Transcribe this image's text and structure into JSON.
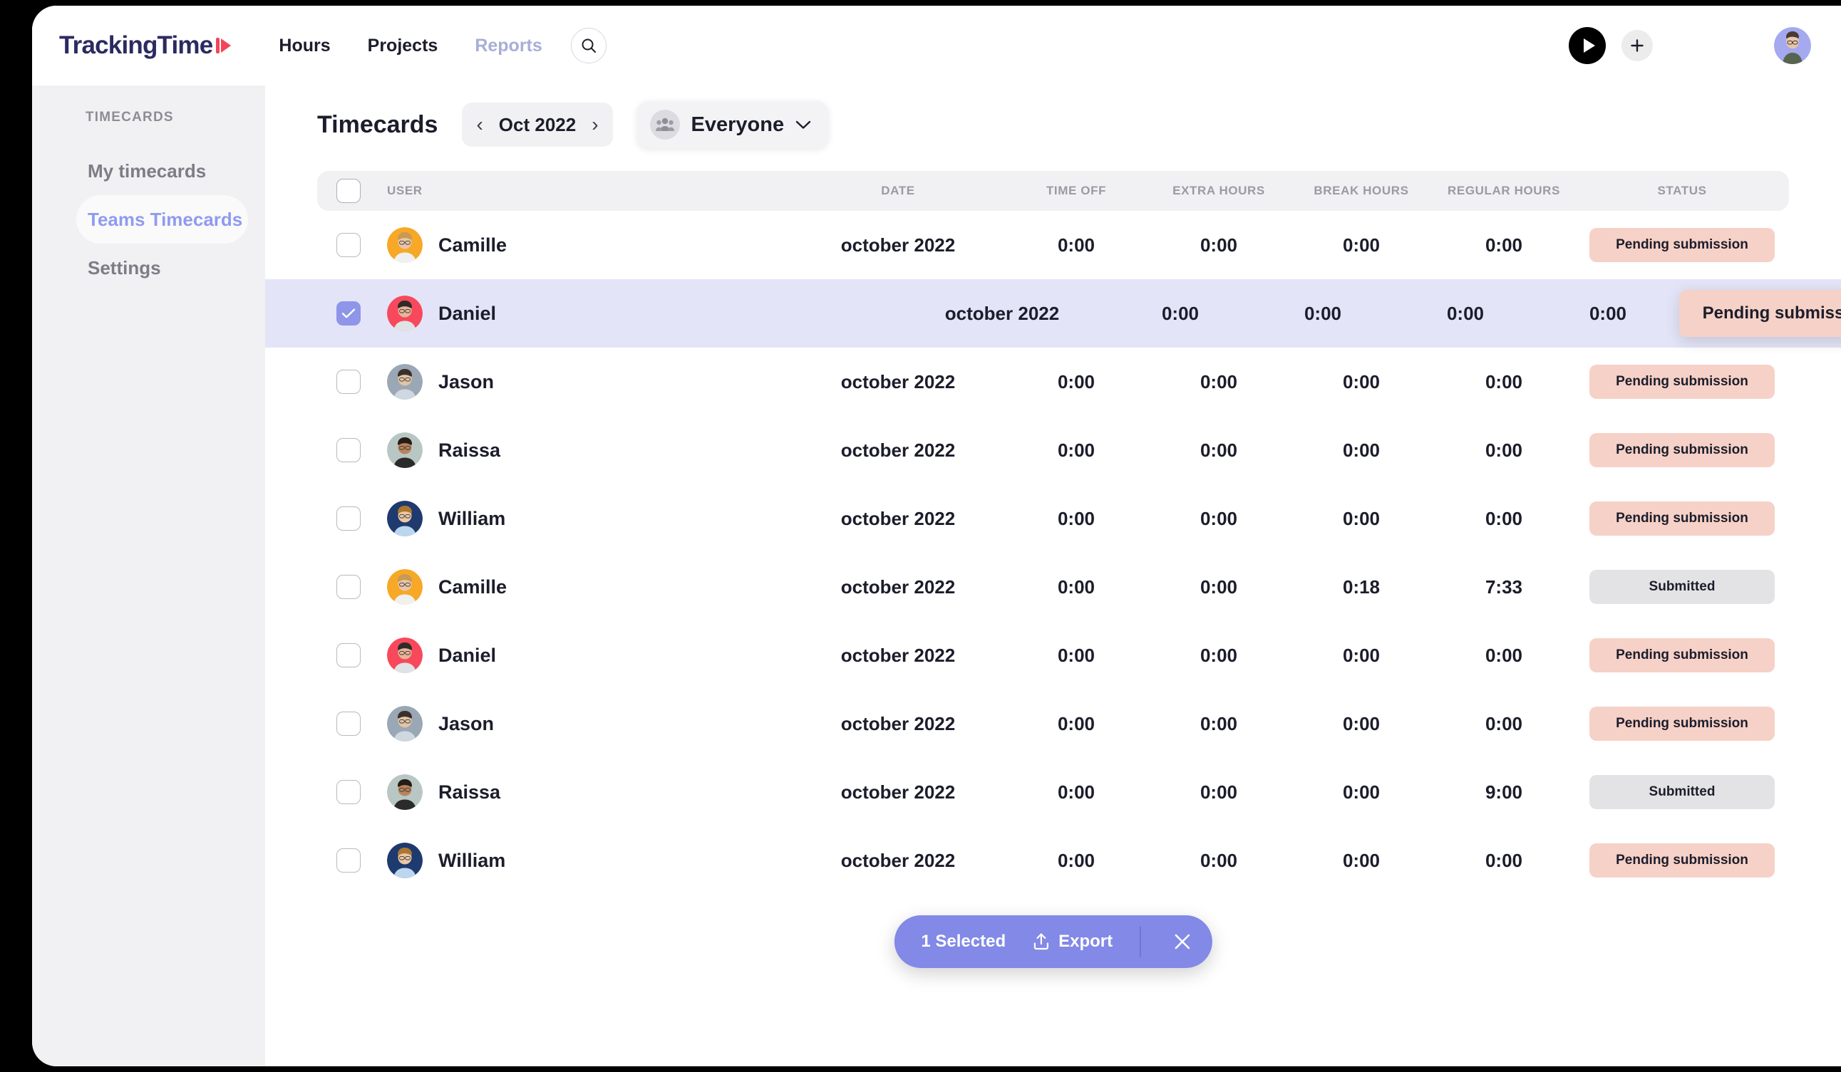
{
  "brand": {
    "name": "TrackingTime",
    "logo_color": "#2b2b60",
    "mark_color": "#f4455a"
  },
  "topnav": {
    "items": [
      {
        "label": "Hours",
        "active": true
      },
      {
        "label": "Projects",
        "active": true
      },
      {
        "label": "Reports",
        "active": false
      }
    ],
    "search_icon": "search-icon",
    "play_icon": "play-icon",
    "add_icon": "plus-icon",
    "avatar_bg": "#a5a9f0"
  },
  "sidebar": {
    "section_title": "TIMECARDS",
    "items": [
      {
        "label": "My timecards",
        "active": false
      },
      {
        "label": "Teams Timecards",
        "active": true
      },
      {
        "label": "Settings",
        "active": false
      }
    ],
    "active_color": "#8f9bf0",
    "bg": "#f1f1f3"
  },
  "header": {
    "title": "Timecards",
    "date_prev_icon": "chevron-left-icon",
    "date_label": "Oct 2022",
    "date_next_icon": "chevron-right-icon",
    "team_icon": "people-group-icon",
    "team_label": "Everyone",
    "team_caret_icon": "chevron-down-icon"
  },
  "table": {
    "columns": [
      "USER",
      "DATE",
      "TIME OFF",
      "EXTRA HOURS",
      "BREAK HOURS",
      "REGULAR HOURS",
      "STATUS"
    ],
    "rows": [
      {
        "user": "Camille",
        "avatar_bg": "#f7a827",
        "date": "october 2022",
        "time_off": "0:00",
        "extra_hours": "0:00",
        "break_hours": "0:00",
        "regular_hours": "0:00",
        "status": "Pending submission",
        "status_kind": "pending",
        "selected": false
      },
      {
        "user": "Daniel",
        "avatar_bg": "#f8495c",
        "date": "october 2022",
        "time_off": "0:00",
        "extra_hours": "0:00",
        "break_hours": "0:00",
        "regular_hours": "0:00",
        "status": "Pending submission",
        "status_kind": "pending",
        "selected": true
      },
      {
        "user": "Jason",
        "avatar_bg": "#9aa7b4",
        "date": "october 2022",
        "time_off": "0:00",
        "extra_hours": "0:00",
        "break_hours": "0:00",
        "regular_hours": "0:00",
        "status": "Pending submission",
        "status_kind": "pending",
        "selected": false
      },
      {
        "user": "Raissa",
        "avatar_bg": "#b9c7c4",
        "date": "october 2022",
        "time_off": "0:00",
        "extra_hours": "0:00",
        "break_hours": "0:00",
        "regular_hours": "0:00",
        "status": "Pending submission",
        "status_kind": "pending",
        "selected": false
      },
      {
        "user": "William",
        "avatar_bg": "#1e3a6e",
        "date": "october 2022",
        "time_off": "0:00",
        "extra_hours": "0:00",
        "break_hours": "0:00",
        "regular_hours": "0:00",
        "status": "Pending submission",
        "status_kind": "pending",
        "selected": false
      },
      {
        "user": "Camille",
        "avatar_bg": "#f7a827",
        "date": "october 2022",
        "time_off": "0:00",
        "extra_hours": "0:00",
        "break_hours": "0:18",
        "regular_hours": "7:33",
        "status": "Submitted",
        "status_kind": "submitted",
        "selected": false
      },
      {
        "user": "Daniel",
        "avatar_bg": "#f8495c",
        "date": "october 2022",
        "time_off": "0:00",
        "extra_hours": "0:00",
        "break_hours": "0:00",
        "regular_hours": "0:00",
        "status": "Pending submission",
        "status_kind": "pending",
        "selected": false
      },
      {
        "user": "Jason",
        "avatar_bg": "#9aa7b4",
        "date": "october 2022",
        "time_off": "0:00",
        "extra_hours": "0:00",
        "break_hours": "0:00",
        "regular_hours": "0:00",
        "status": "Pending submission",
        "status_kind": "pending",
        "selected": false
      },
      {
        "user": "Raissa",
        "avatar_bg": "#b9c7c4",
        "date": "october 2022",
        "time_off": "0:00",
        "extra_hours": "0:00",
        "break_hours": "0:00",
        "regular_hours": "9:00",
        "status": "Submitted",
        "status_kind": "submitted",
        "selected": false
      },
      {
        "user": "William",
        "avatar_bg": "#1e3a6e",
        "date": "october 2022",
        "time_off": "0:00",
        "extra_hours": "0:00",
        "break_hours": "0:00",
        "regular_hours": "0:00",
        "status": "Pending submission",
        "status_kind": "pending",
        "selected": false
      }
    ],
    "header_checkbox_checked": false,
    "selected_row_bg": "#e4e4f8",
    "badge_pending_bg": "#f6d1c7",
    "badge_submitted_bg": "#e3e3e5"
  },
  "action_bar": {
    "selected_label": "1 Selected",
    "export_label": "Export",
    "export_icon": "upload-icon",
    "close_icon": "close-icon",
    "bg": "#8289e6"
  }
}
